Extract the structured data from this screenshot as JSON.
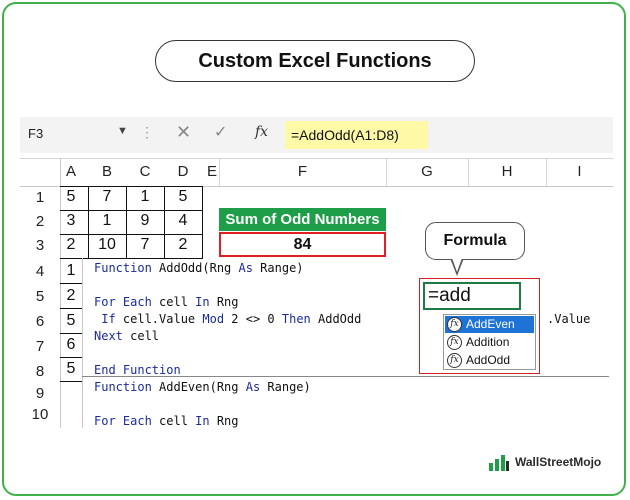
{
  "title": "Custom Excel Functions",
  "formula_bar": {
    "name_box": "F3",
    "formula": "=AddOdd(A1:D8)",
    "fx_label": "fx",
    "cancel_glyph": "✕",
    "enter_glyph": "✓"
  },
  "columns": [
    "A",
    "B",
    "C",
    "D",
    "E",
    "F",
    "G",
    "H",
    "I"
  ],
  "rows": [
    "1",
    "2",
    "3",
    "4",
    "5",
    "6",
    "7",
    "8",
    "9",
    "10"
  ],
  "grid_values": {
    "r1": [
      "5",
      "7",
      "1",
      "5"
    ],
    "r2": [
      "3",
      "1",
      "9",
      "4"
    ],
    "r3": [
      "2",
      "10",
      "7",
      "2"
    ],
    "col_a_rest": [
      "1",
      "2",
      "5",
      "6",
      "5"
    ]
  },
  "sum_label": "Sum of Odd Numbers",
  "sum_value": "84",
  "code": {
    "l1_kw": "Function",
    "l1_rest": " AddOdd(Rng ",
    "l1_kw2": "As",
    "l1_rest2": " Range)",
    "l2_kw": "For Each",
    "l2_rest": " cell ",
    "l2_kw2": "In",
    "l2_rest2": " Rng",
    "l3_kw": " If",
    "l3_rest": " cell.Value ",
    "l3_kw2": "Mod",
    "l3_rest2": " 2 <> 0 ",
    "l3_kw3": "Then",
    "l3_rest3": " AddOdd",
    "l3_tail": ".Value",
    "l4_kw": "Next",
    "l4_rest": " cell",
    "l5_kw": "End Function",
    "l6_kw": "Function",
    "l6_rest": " AddEven(Rng ",
    "l6_kw2": "As",
    "l6_rest2": " Range)",
    "l7_kw": "For Each",
    "l7_rest": " cell ",
    "l7_kw2": "In",
    "l7_rest2": " Rng"
  },
  "callout": "Formula",
  "formula_cell_text": "=add",
  "autocomplete": {
    "items": [
      "AddEven",
      "Addition",
      "AddOdd"
    ],
    "selected": "AddEven"
  },
  "brand": "WallStreetMojo",
  "colors": {
    "accent_green": "#1e9e48",
    "highlight_red": "#e02020",
    "formula_yellow": "#fef9a6",
    "code_keyword": "#1a2c9c",
    "selection_blue": "#1e73d6"
  }
}
